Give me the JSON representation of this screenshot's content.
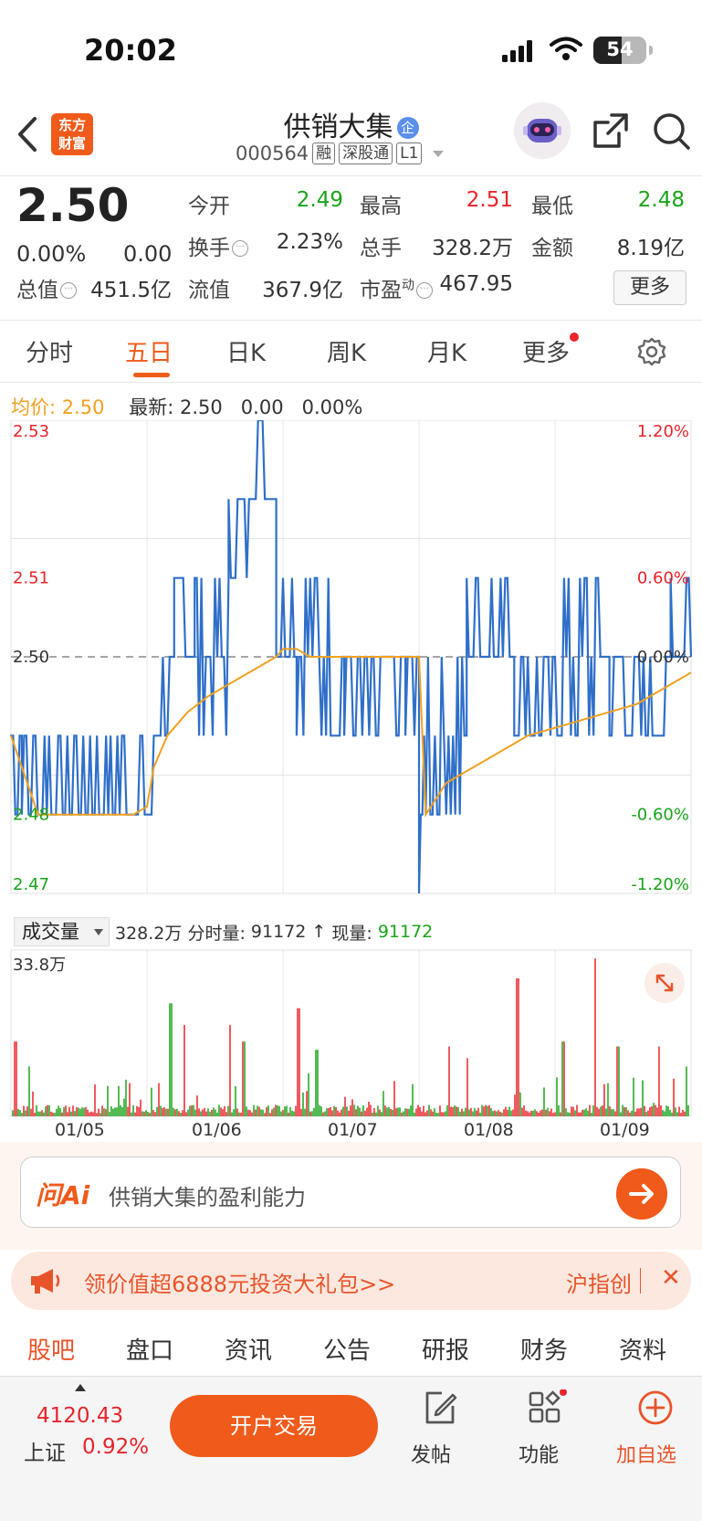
{
  "status_bar": {
    "time": "20:02",
    "battery": "54",
    "battery_level": 0.54
  },
  "nav": {
    "logo_line1": "东方",
    "logo_line2": "财富",
    "title": "供销大集",
    "title_badge": "企",
    "code": "000564",
    "tags": [
      "融",
      "深股通",
      "L1"
    ]
  },
  "quote": {
    "price": "2.50",
    "change_pct": "0.00%",
    "change": "0.00",
    "open_label": "今开",
    "open": "2.49",
    "high_label": "最高",
    "high": "2.51",
    "low_label": "最低",
    "low": "2.48",
    "turnover_label": "换手",
    "turnover": "2.23%",
    "volume_label": "总手",
    "volume": "328.2万",
    "amount_label": "金额",
    "amount": "8.19亿",
    "mktcap_label": "总值",
    "mktcap": "451.5亿",
    "float_label": "流值",
    "float": "367.9亿",
    "pe_label": "市盈",
    "pe_sup": "动",
    "pe": "467.95",
    "more": "更多"
  },
  "tabs": [
    "分时",
    "五日",
    "日K",
    "周K",
    "月K",
    "更多"
  ],
  "active_tab": "五日",
  "avg_line": {
    "label": "均价:",
    "value": "2.50",
    "latest_label": "最新:",
    "latest": "2.50",
    "change": "0.00",
    "pct": "0.00%"
  },
  "colors": {
    "accent": "#f05a1a",
    "up": "#e8242a",
    "down": "#1aa31a",
    "price_line": "#2f6fc9",
    "avg_line": "#f0a020"
  },
  "chart_data": [
    {
      "type": "line",
      "y_ticks_left": [
        "2.53",
        "2.51",
        "2.50",
        "2.48",
        "2.47"
      ],
      "y_ticks_right": [
        "1.20%",
        "0.60%",
        "0.00%",
        "-0.60%",
        "-1.20%"
      ],
      "ylim": [
        2.47,
        2.53
      ],
      "reference": 2.5,
      "x_days": [
        "01/05",
        "01/06",
        "01/07",
        "01/08",
        "01/09"
      ],
      "series": [
        {
          "x": [
            0.0,
            0.1,
            0.2,
            0.35,
            0.5,
            0.6,
            0.7,
            0.8,
            0.9,
            1.0,
            1.05,
            1.15,
            1.3,
            1.45,
            1.55,
            1.65,
            1.75,
            1.85,
            1.95,
            2.0,
            2.1,
            2.2,
            2.3,
            2.45,
            2.6,
            2.75,
            2.9,
            3.0,
            3.05,
            3.2,
            3.4,
            3.6,
            3.8,
            4.0,
            4.2,
            4.4,
            4.6,
            4.8,
            5.0
          ],
          "values": [
            2.49,
            2.485,
            2.48,
            2.48,
            2.48,
            2.48,
            2.48,
            2.48,
            2.48,
            2.481,
            2.486,
            2.49,
            2.493,
            2.495,
            2.496,
            2.497,
            2.498,
            2.499,
            2.5,
            2.501,
            2.501,
            2.5,
            2.5,
            2.5,
            2.5,
            2.5,
            2.5,
            2.5,
            2.48,
            2.484,
            2.486,
            2.488,
            2.49,
            2.491,
            2.492,
            2.493,
            2.494,
            2.496,
            2.498
          ]
        }
      ]
    },
    {
      "type": "bar",
      "title": "成交量",
      "ylabel": "33.8万",
      "total": "328.2万",
      "period_label": "分时量:",
      "period_volume": "91172",
      "now_label": "现量:",
      "now_volume": "91172",
      "x_days": [
        "01/05",
        "01/06",
        "01/07",
        "01/08",
        "01/09"
      ]
    }
  ],
  "ai": {
    "logo": "问Ai",
    "placeholder": "供销大集的盈利能力"
  },
  "promo": {
    "text": "领价值超6888元投资大礼包>>",
    "sub": "沪指创"
  },
  "bottom_tabs": [
    "股吧",
    "盘口",
    "资讯",
    "公告",
    "研报",
    "财务",
    "资料"
  ],
  "footer": {
    "index_value": "4120.43",
    "index_name": "上证",
    "index_pct": "0.92%",
    "trade": "开户交易",
    "post": "发帖",
    "func": "功能",
    "add": "加自选"
  }
}
